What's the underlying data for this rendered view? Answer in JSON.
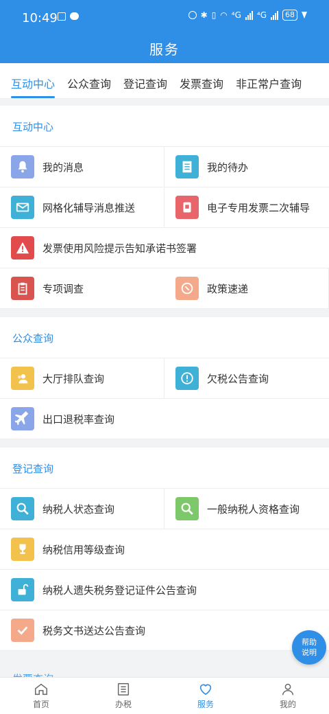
{
  "status": {
    "time": "10:49",
    "battery": "68",
    "signal1": "⁴G",
    "signal2": "⁴G"
  },
  "header": {
    "title": "服务"
  },
  "tabs": [
    "互动中心",
    "公众查询",
    "登记查询",
    "发票查询",
    "非正常户查询"
  ],
  "sections": {
    "hudong": {
      "title": "互动中心",
      "items": [
        {
          "label": "我的消息",
          "icon": "bell-icon",
          "color": "#8aa6e8"
        },
        {
          "label": "我的待办",
          "icon": "document-icon",
          "color": "#3fb0d6"
        },
        {
          "label": "网格化辅导消息推送",
          "icon": "envelope-icon",
          "color": "#3fb0d6"
        },
        {
          "label": "电子专用发票二次辅导",
          "icon": "invoice-icon",
          "color": "#e8656a"
        },
        {
          "label": "发票使用风险提示告知承诺书签署",
          "icon": "warning-icon",
          "color": "#e24b4b"
        },
        {
          "label": "专项调查",
          "icon": "clipboard-icon",
          "color": "#d9534f"
        },
        {
          "label": "政策速递",
          "icon": "compass-icon",
          "color": "#f4a98b"
        }
      ]
    },
    "gongzhong": {
      "title": "公众查询",
      "items": [
        {
          "label": "大厅排队查询",
          "icon": "queue-icon",
          "color": "#f3c24d"
        },
        {
          "label": "欠税公告查询",
          "icon": "alert-icon",
          "color": "#3fb0d6"
        },
        {
          "label": "出口退税率查询",
          "icon": "airplane-icon",
          "color": "#8aa6e8"
        }
      ]
    },
    "dengji": {
      "title": "登记查询",
      "items": [
        {
          "label": "纳税人状态查询",
          "icon": "magnifier-icon",
          "color": "#3fb0d6"
        },
        {
          "label": "一般纳税人资格查询",
          "icon": "search-green-icon",
          "color": "#7cc86a"
        },
        {
          "label": "纳税信用等级查询",
          "icon": "trophy-icon",
          "color": "#f3c24d"
        },
        {
          "label": "纳税人遗失税务登记证件公告查询",
          "icon": "unlock-icon",
          "color": "#3fb0d6"
        },
        {
          "label": "税务文书送达公告查询",
          "icon": "check-icon",
          "color": "#f4a98b"
        }
      ]
    },
    "fapiao": {
      "title": "发票查询"
    }
  },
  "fab": {
    "line1": "帮助",
    "line2": "说明"
  },
  "nav": [
    {
      "label": "首页",
      "icon": "home-icon"
    },
    {
      "label": "办税",
      "icon": "list-icon"
    },
    {
      "label": "服务",
      "icon": "heart-icon"
    },
    {
      "label": "我的",
      "icon": "user-icon"
    }
  ],
  "accent": "#2f8ee6"
}
